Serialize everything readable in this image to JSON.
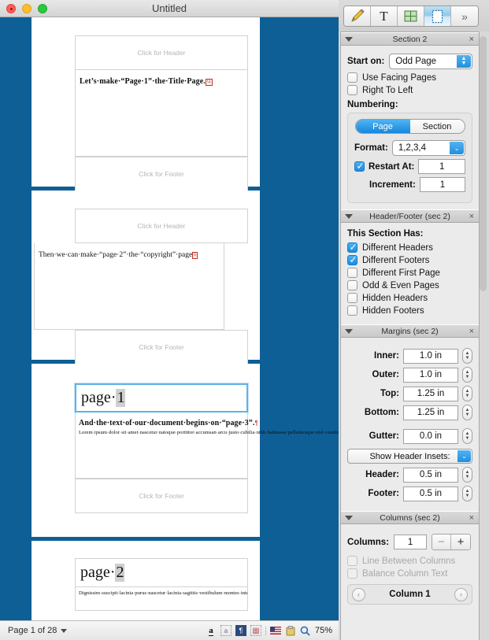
{
  "window": {
    "title": "Untitled",
    "traffic_lights": [
      "close",
      "minimize",
      "zoom"
    ]
  },
  "document": {
    "header_placeholder": "Click for Header",
    "footer_placeholder": "Click for Footer",
    "pages": [
      {
        "name": "page-1",
        "header": "Click for Header",
        "footer": "Click for Footer",
        "body_bold": "Let’s·make·“Page·1”·the·Title·Page.",
        "section_break": "\\1"
      },
      {
        "name": "page-2",
        "header": "Click for Header",
        "footer": "Click for Footer",
        "body_plain": "Then·we·can·make·“page·2”·the·“copyright”·page",
        "section_break": "s"
      },
      {
        "name": "page-3",
        "header_text": "page",
        "header_number": "1",
        "footer": "Click for Footer",
        "body_bold": "And·the·text·of·our·document·begins·on·“page·3”.",
        "pilcrow": "¶",
        "body_plain": "Lorem·ipsum·dolor·sit·amet·nascetur·natoque·porttitor·accumsan·arcu·justo·cubilia·nibh·habitasse·pellentesque·nisl·condimentum·dictumst.·Interdum·nascetur,·justo·velit·metus·lectus·justo·maecenas·leo·sit·luctus·tincidunt·libero.·"
      },
      {
        "name": "page-4",
        "header_text": "page",
        "header_number": "2",
        "body_plain": "Dignissim·suscipit·lacinia·purus·nascetur·lacinia·sagittis·vestibulum·montes·integer·fringilla·donec.·lacinia·iaculis·magnis·sed·ut·facilisis.·Tristique·cum·parturient·faucibus·"
      }
    ]
  },
  "statusbar": {
    "page_indicator": "Page 1 of 28",
    "dropdown_caret": "caret-down",
    "icons": [
      {
        "name": "spelling-icon",
        "glyph": "a"
      },
      {
        "name": "invisibles-layout-icon",
        "glyph": "a"
      },
      {
        "name": "show-invisibles-icon",
        "glyph": "¶"
      },
      {
        "name": "grid-icon",
        "glyph": "▦"
      },
      {
        "name": "language-flag-icon",
        "glyph": "flag"
      },
      {
        "name": "clipboard-icon",
        "glyph": "clipboard"
      },
      {
        "name": "zoom-icon",
        "glyph": "search"
      }
    ],
    "zoom_level": "75%"
  },
  "inspector": {
    "toolbar": [
      {
        "name": "pencil-icon",
        "label": "Style",
        "active": false
      },
      {
        "name": "text-icon",
        "label": "Text",
        "active": false
      },
      {
        "name": "table-icon",
        "label": "Table",
        "active": false
      },
      {
        "name": "page-section-icon",
        "label": "Page",
        "active": true
      },
      {
        "name": "more-chevrons-icon",
        "label": "More",
        "active": false
      }
    ],
    "section": {
      "title": "Section 2",
      "close": "×",
      "start_on_label": "Start on:",
      "start_on_value": "Odd Page",
      "use_facing_pages": "Use Facing Pages",
      "right_to_left": "Right To Left",
      "numbering_label": "Numbering:",
      "segmented": {
        "page": "Page",
        "section": "Section",
        "selected": "Page"
      },
      "format_label": "Format:",
      "format_value": "1,2,3,4",
      "restart_at_label": "Restart At:",
      "restart_at_value": "1",
      "restart_at_checked": true,
      "increment_label": "Increment:",
      "increment_value": "1"
    },
    "header_footer": {
      "title": "Header/Footer (sec 2)",
      "close": "×",
      "heading": "This Section Has:",
      "options": [
        {
          "label": "Different Headers",
          "checked": true,
          "enabled": true
        },
        {
          "label": "Different Footers",
          "checked": true,
          "enabled": true
        },
        {
          "label": "Different First Page",
          "checked": false,
          "enabled": true
        },
        {
          "label": "Odd & Even Pages",
          "checked": false,
          "enabled": true
        },
        {
          "label": "Hidden Headers",
          "checked": false,
          "enabled": true
        },
        {
          "label": "Hidden Footers",
          "checked": false,
          "enabled": true
        }
      ]
    },
    "margins": {
      "title": "Margins (sec 2)",
      "close": "×",
      "fields": [
        {
          "label": "Inner:",
          "value": "1.0 in"
        },
        {
          "label": "Outer:",
          "value": "1.0 in"
        },
        {
          "label": "Top:",
          "value": "1.25 in"
        },
        {
          "label": "Bottom:",
          "value": "1.25 in"
        }
      ],
      "gutter_label": "Gutter:",
      "gutter_value": "0.0 in",
      "insets_popup": "Show Header Insets:",
      "header_label": "Header:",
      "header_value": "0.5 in",
      "footer_label": "Footer:",
      "footer_value": "0.5 in"
    },
    "columns": {
      "title": "Columns (sec 2)",
      "close": "×",
      "columns_label": "Columns:",
      "columns_value": "1",
      "minus": "−",
      "plus": "+",
      "line_between": "Line Between Columns",
      "balance_text": "Balance Column Text",
      "nav_prev": "‹",
      "nav_label": "Column 1",
      "nav_next": "›"
    }
  },
  "colors": {
    "canvas_blue": "#0e5f96",
    "accent_blue": "#1f8fe0",
    "selection_blue": "#5fb2e8",
    "break_red": "#c0392b"
  }
}
